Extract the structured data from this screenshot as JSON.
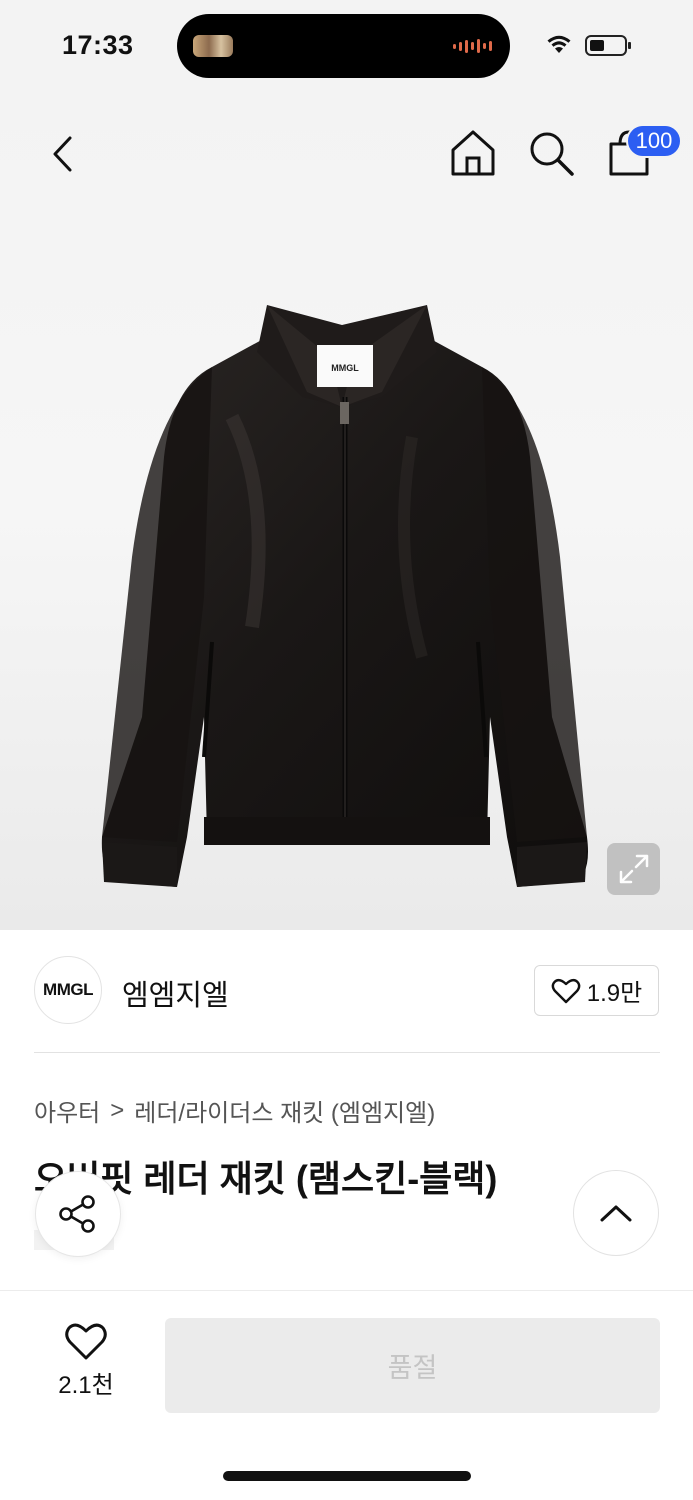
{
  "status_bar": {
    "time": "17:33",
    "battery_level": 0.45
  },
  "nav": {
    "cart_badge": "100"
  },
  "product_image": {
    "brand_tag": "MMGL"
  },
  "brand": {
    "logo_text": "MMGL",
    "name": "엠엠지엘",
    "like_count": "1.9만"
  },
  "breadcrumb": {
    "category": "아우터",
    "separator": ">",
    "subcategory": "레더/라이더스 재킷 (엠엠지엘)"
  },
  "product": {
    "title": "오버핏 레더 재킷 (램스킨-블랙)"
  },
  "bottom_bar": {
    "wish_count": "2.1천",
    "buy_button": "품절"
  },
  "colors": {
    "badge": "#2c5ef2",
    "soldout_bg": "#ebebeb",
    "soldout_text": "#c4c4c4"
  }
}
